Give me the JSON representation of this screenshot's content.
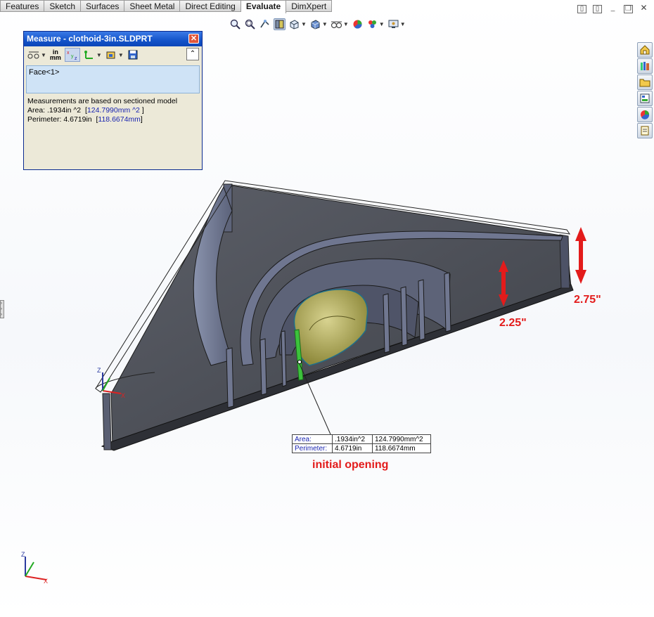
{
  "tabs": [
    {
      "label": "Features"
    },
    {
      "label": "Sketch"
    },
    {
      "label": "Surfaces"
    },
    {
      "label": "Sheet Metal"
    },
    {
      "label": "Direct Editing"
    },
    {
      "label": "Evaluate"
    },
    {
      "label": "DimXpert"
    }
  ],
  "active_tab": "Evaluate",
  "measure": {
    "title": "Measure - clothoid-3in.SLDPRT",
    "units_label_top": "in",
    "units_label_bottom": "mm",
    "selection": "Face<1>",
    "note": "Measurements are based on sectioned model",
    "area_label": "Area: .1934in ^2",
    "area_alt": "124.7990mm ^2",
    "perimeter_label": "Perimeter: 4.6719in",
    "perimeter_alt": "118.6674mm"
  },
  "callout": {
    "rows": [
      {
        "label": "Area:",
        "value_in": ".1934in^2",
        "value_mm": "124.7990mm^2"
      },
      {
        "label": "Perimeter:",
        "value_in": "4.6719in",
        "value_mm": "118.6674mm"
      }
    ]
  },
  "annotations": {
    "height_outer": "2.75\"",
    "height_inner": "2.25\"",
    "opening": "initial opening"
  },
  "triad": {
    "z": "Z",
    "x": "X"
  },
  "colors": {
    "accent_red": "#e31b1b",
    "title_blue": "#1353c9",
    "face_green": "#3cc23c"
  }
}
